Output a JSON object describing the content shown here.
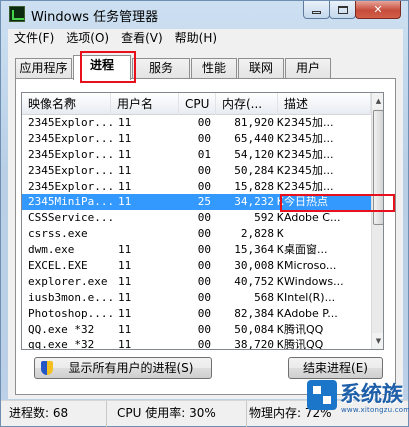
{
  "window": {
    "title": "Windows 任务管理器",
    "min_icon": "minimize-icon",
    "max_icon": "maximize-icon",
    "close_icon": "close-icon",
    "close_glyph": "✕"
  },
  "menu": [
    {
      "label": "文件(F)"
    },
    {
      "label": "选项(O)"
    },
    {
      "label": "查看(V)"
    },
    {
      "label": "帮助(H)"
    }
  ],
  "tabs": [
    {
      "label": "应用程序"
    },
    {
      "label": "进程",
      "active": true
    },
    {
      "label": "服务"
    },
    {
      "label": "性能"
    },
    {
      "label": "联网"
    },
    {
      "label": "用户"
    }
  ],
  "table": {
    "columns": [
      "映像名称",
      "用户名",
      "CPU",
      "内存(...",
      "描述"
    ],
    "sort_glyph": "▲",
    "rows": [
      {
        "name": "2345Explor...",
        "user": "11",
        "cpu": "00",
        "mem": "81,920",
        "unit": "K",
        "desc": "2345加..."
      },
      {
        "name": "2345Explor...",
        "user": "11",
        "cpu": "00",
        "mem": "65,440",
        "unit": "K",
        "desc": "2345加..."
      },
      {
        "name": "2345Explor...",
        "user": "11",
        "cpu": "01",
        "mem": "54,120",
        "unit": "K",
        "desc": "2345加..."
      },
      {
        "name": "2345Explor...",
        "user": "11",
        "cpu": "00",
        "mem": "50,284",
        "unit": "K",
        "desc": "2345加..."
      },
      {
        "name": "2345Explor...",
        "user": "11",
        "cpu": "00",
        "mem": "15,828",
        "unit": "K",
        "desc": "2345加..."
      },
      {
        "name": "2345MiniPa...",
        "user": "11",
        "cpu": "25",
        "mem": "34,232",
        "unit": "K",
        "desc": "今日热点",
        "selected": true
      },
      {
        "name": "CSSService...",
        "user": "",
        "cpu": "00",
        "mem": "592",
        "unit": "K",
        "desc": "Adobe C..."
      },
      {
        "name": "csrss.exe",
        "user": "",
        "cpu": "00",
        "mem": "2,828",
        "unit": "K",
        "desc": ""
      },
      {
        "name": "dwm.exe",
        "user": "11",
        "cpu": "00",
        "mem": "15,364",
        "unit": "K",
        "desc": "桌面窗..."
      },
      {
        "name": "EXCEL.EXE",
        "user": "11",
        "cpu": "00",
        "mem": "30,008",
        "unit": "K",
        "desc": "Microso..."
      },
      {
        "name": "explorer.exe",
        "user": "11",
        "cpu": "00",
        "mem": "40,752",
        "unit": "K",
        "desc": "Windows..."
      },
      {
        "name": "iusb3mon.e...",
        "user": "11",
        "cpu": "00",
        "mem": "568",
        "unit": "K",
        "desc": "Intel(R)..."
      },
      {
        "name": "Photoshop....",
        "user": "11",
        "cpu": "00",
        "mem": "82,384",
        "unit": "K",
        "desc": "Adobe P..."
      },
      {
        "name": "QQ.exe *32",
        "user": "11",
        "cpu": "00",
        "mem": "50,084",
        "unit": "K",
        "desc": "腾讯QQ"
      },
      {
        "name": "qq.exe *32",
        "user": "11",
        "cpu": "00",
        "mem": "38,720",
        "unit": "K",
        "desc": "腾讯QQ"
      }
    ]
  },
  "scrollbar": {
    "up": "▲",
    "down": "▼"
  },
  "buttons": {
    "show_all": "显示所有用户的进程(S)",
    "end_process": "结束进程(E)",
    "shield_icon": "uac-shield-icon"
  },
  "status": {
    "processes": "进程数: 68",
    "cpu": "CPU 使用率: 30%",
    "memory": "物理内存: 72%"
  },
  "watermark": {
    "brand": "系统族",
    "url": "www.xitongzu.com"
  },
  "colors": {
    "highlight_border": "#e8101c",
    "selection": "#3399ff"
  }
}
